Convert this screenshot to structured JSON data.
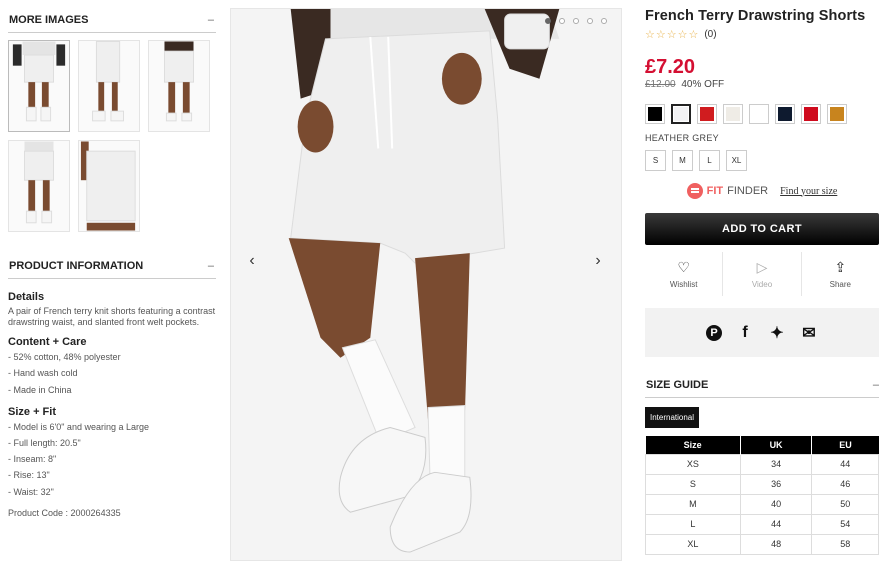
{
  "more_images": {
    "title": "MORE IMAGES",
    "toggle": "–",
    "thumbs": [
      "front-view",
      "side-view",
      "back-view",
      "front-full-view",
      "detail-view"
    ]
  },
  "product_info": {
    "title": "PRODUCT INFORMATION",
    "toggle": "–",
    "details_title": "Details",
    "details_text": "A pair of French terry knit shorts featuring a contrast drawstring waist, and slanted front welt pockets.",
    "care_title": "Content + Care",
    "care_items": [
      "- 52% cotton, 48% polyester",
      "- Hand wash cold",
      "- Made in China"
    ],
    "fit_title": "Size + Fit",
    "fit_items": [
      "- Model is 6'0\" and wearing a Large",
      "- Full length: 20.5\"",
      "- Inseam: 8\"",
      "- Rise: 13\"",
      "- Waist: 32\""
    ],
    "product_code": "Product Code : 2000264335"
  },
  "gallery": {
    "prev": "‹",
    "next": "›",
    "dots": 5,
    "active_dot": 0
  },
  "product": {
    "title": "French Terry Drawstring Shorts",
    "stars": "☆☆☆☆☆",
    "reviews": "(0)",
    "price": "£7.20",
    "old_price": "£12.00",
    "discount": "40% OFF",
    "colors": [
      "#000000",
      "#f2f2f4",
      "#d01c1f",
      "#efece6",
      "#ffffff",
      "#0e1a2f",
      "#cf0a1d",
      "#c8841e"
    ],
    "selected_color_index": 1,
    "color_name": "HEATHER GREY",
    "sizes": [
      "S",
      "M",
      "L",
      "XL"
    ]
  },
  "fit_finder": {
    "brand_bold": "FIT",
    "brand_rest": "FINDER",
    "link": "Find your size"
  },
  "cart": {
    "label": "ADD TO CART"
  },
  "actions": {
    "wishlist": "Wishlist",
    "video": "Video",
    "share": "Share"
  },
  "social": [
    "pinterest-icon",
    "facebook-icon",
    "twitter-icon",
    "email-icon"
  ],
  "size_guide": {
    "title": "SIZE GUIDE",
    "toggle": "–",
    "tab": "International",
    "headers": [
      "Size",
      "UK",
      "EU"
    ],
    "rows": [
      [
        "XS",
        "34",
        "44"
      ],
      [
        "S",
        "36",
        "46"
      ],
      [
        "M",
        "40",
        "50"
      ],
      [
        "L",
        "44",
        "54"
      ],
      [
        "XL",
        "48",
        "58"
      ]
    ]
  }
}
